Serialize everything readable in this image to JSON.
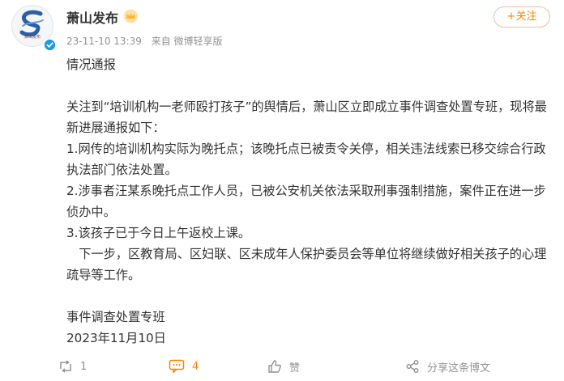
{
  "post": {
    "author": "萧山发布",
    "avatar_text": "萧山发布",
    "time": "23-11-10 13:39",
    "source": "来自 微博轻享版",
    "follow_label": "+关注",
    "paragraphs": [
      "情况通报",
      "关注到“培训机构一老师殴打孩子”的舆情后，萧山区立即成立事件调查处置专班，现将最新进展通报如下：",
      "1.网传的培训机构实际为晚托点；该晚托点已被责令关停，相关违法线索已移交综合行政执法部门依法处置。",
      "2.涉事者汪某系晚托点工作人员，已被公安机关依法采取刑事强制措施，案件正在进一步侦办中。",
      "3.该孩子已于今日上午返校上课。",
      "下一步，区教育局、区妇联、区未成年人保护委员会等单位将继续做好相关孩子的心理疏导等工作。",
      "事件调查处置专班",
      "2023年11月10日"
    ]
  },
  "actions": {
    "repost_count": "1",
    "comment_count": "4",
    "like_label": "赞",
    "share_label": "分享这条博文"
  },
  "colors": {
    "accent": "#ff8200",
    "text": "#333333",
    "muted": "#939393",
    "verified": "#1a9ae8"
  },
  "icons": [
    "avatar-logo",
    "verified-icon",
    "crown-icon",
    "repost-icon",
    "comment-icon",
    "like-icon",
    "share-icon"
  ]
}
